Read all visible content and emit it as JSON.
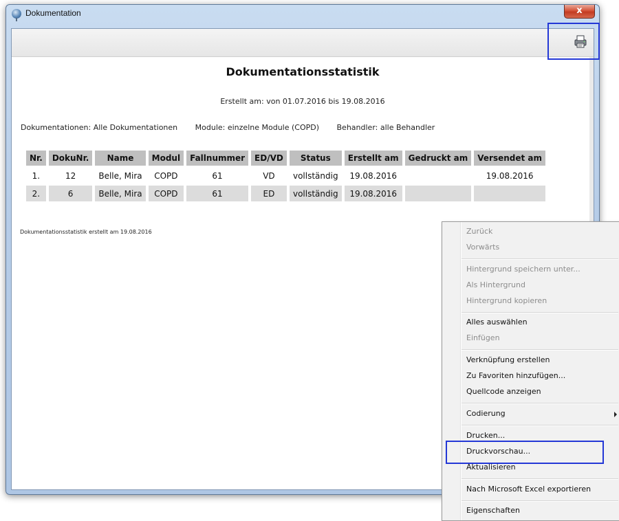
{
  "window": {
    "title": "Dokumentation",
    "close_label": "x"
  },
  "toolbar": {
    "print_icon": "printer-icon"
  },
  "document": {
    "title": "Dokumentationsstatistik",
    "date_range": "Erstellt am: von 01.07.2016 bis 19.08.2016",
    "filters": {
      "documentations": "Dokumentationen: Alle Dokumentationen",
      "modules": "Module: einzelne Module (COPD)",
      "practitioners": "Behandler: alle Behandler"
    },
    "table": {
      "headers": [
        "Nr.",
        "DokuNr.",
        "Name",
        "Modul",
        "Fallnummer",
        "ED/VD",
        "Status",
        "Erstellt am",
        "Gedruckt am",
        "Versendet am"
      ],
      "rows": [
        [
          "1.",
          "12",
          "Belle, Mira",
          "COPD",
          "61",
          "VD",
          "vollständig",
          "19.08.2016",
          "",
          "19.08.2016"
        ],
        [
          "2.",
          "6",
          "Belle, Mira",
          "COPD",
          "61",
          "ED",
          "vollständig",
          "19.08.2016",
          "",
          ""
        ]
      ]
    },
    "footer_note": "Dokumentationsstatistik erstellt am 19.08.2016"
  },
  "context_menu": {
    "items": [
      {
        "label": "Zurück",
        "enabled": false
      },
      {
        "label": "Vorwärts",
        "enabled": false
      },
      {
        "label": "Hintergrund speichern unter...",
        "enabled": false
      },
      {
        "label": "Als Hintergrund",
        "enabled": false
      },
      {
        "label": "Hintergrund kopieren",
        "enabled": false
      },
      {
        "label": "Alles auswählen",
        "enabled": true
      },
      {
        "label": "Einfügen",
        "enabled": false
      },
      {
        "label": "Verknüpfung erstellen",
        "enabled": true
      },
      {
        "label": "Zu Favoriten hinzufügen...",
        "enabled": true
      },
      {
        "label": "Quellcode anzeigen",
        "enabled": true
      },
      {
        "label": "Codierung",
        "enabled": true
      },
      {
        "label": "Drucken...",
        "enabled": true
      },
      {
        "label": "Druckvorschau...",
        "enabled": true
      },
      {
        "label": "Aktualisieren",
        "enabled": true
      },
      {
        "label": "Nach Microsoft Excel exportieren",
        "enabled": true
      },
      {
        "label": "Eigenschaften",
        "enabled": true
      }
    ]
  },
  "colors": {
    "highlight": "#2337d6",
    "table_header_bg": "#bfbfbf",
    "shaded_row_bg": "#dcdcdc",
    "close_button": "#c23b22"
  }
}
